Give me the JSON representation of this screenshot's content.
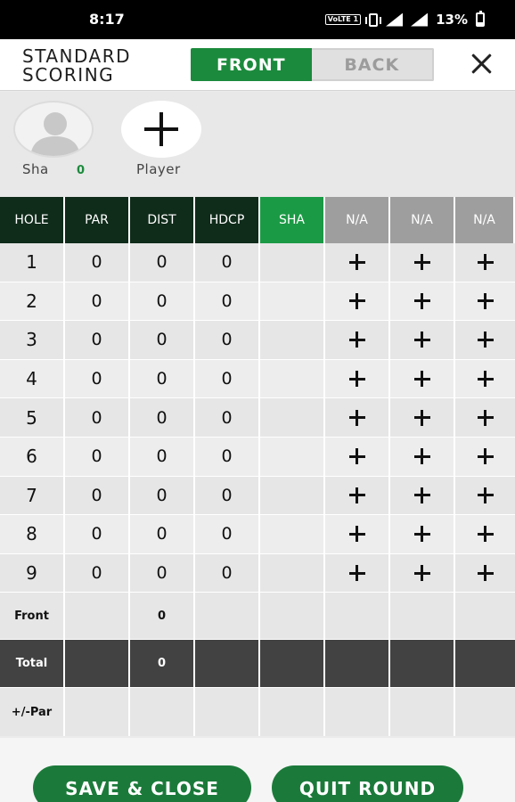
{
  "status_bar": {
    "time": "8:17",
    "volte": "VoLTE 1",
    "battery": "13%"
  },
  "header": {
    "title": "STANDARD\nSCORING",
    "tab_front": "FRONT",
    "tab_back": "BACK",
    "active_tab": "FRONT"
  },
  "players": {
    "player1_name": "Sha",
    "player1_score": "0",
    "add_label": "Player"
  },
  "table": {
    "headers": [
      "HOLE",
      "PAR",
      "DIST",
      "HDCP",
      "SHA",
      "N/A",
      "N/A",
      "N/A"
    ],
    "holes": [
      {
        "hole": "1",
        "par": "0",
        "dist": "0",
        "hdcp": "0"
      },
      {
        "hole": "2",
        "par": "0",
        "dist": "0",
        "hdcp": "0"
      },
      {
        "hole": "3",
        "par": "0",
        "dist": "0",
        "hdcp": "0"
      },
      {
        "hole": "4",
        "par": "0",
        "dist": "0",
        "hdcp": "0"
      },
      {
        "hole": "5",
        "par": "0",
        "dist": "0",
        "hdcp": "0"
      },
      {
        "hole": "6",
        "par": "0",
        "dist": "0",
        "hdcp": "0"
      },
      {
        "hole": "7",
        "par": "0",
        "dist": "0",
        "hdcp": "0"
      },
      {
        "hole": "8",
        "par": "0",
        "dist": "0",
        "hdcp": "0"
      },
      {
        "hole": "9",
        "par": "0",
        "dist": "0",
        "hdcp": "0"
      }
    ],
    "front_label": "Front",
    "front_dist": "0",
    "total_label": "Total",
    "total_dist": "0",
    "par_label": "+/-Par"
  },
  "buttons": {
    "save": "SAVE & CLOSE",
    "quit": "QUIT ROUND"
  },
  "colors": {
    "green": "#1b8a3c",
    "dark_green": "#0f2b1a",
    "gray_header": "#9e9e9e",
    "total_row": "#424242"
  }
}
